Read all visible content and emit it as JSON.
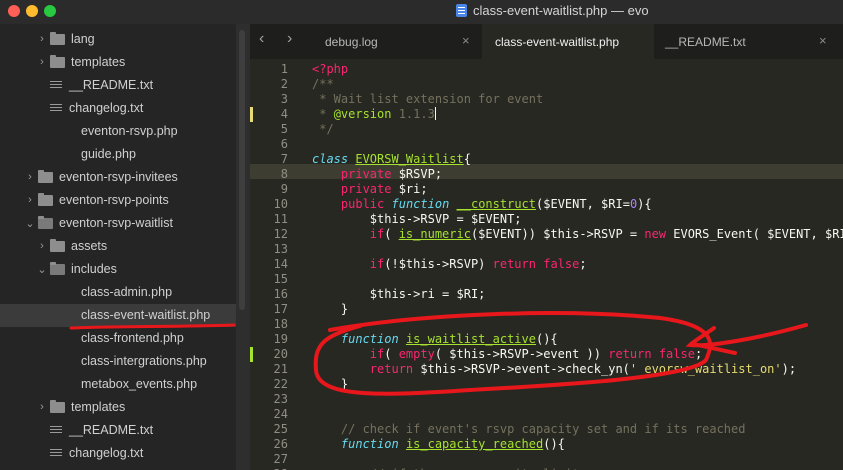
{
  "window": {
    "title": "class-event-waitlist.php — evo"
  },
  "colors": {
    "annotation_red": "#e8171b",
    "modified_marker_yellow": "#e6db74",
    "modified_marker_green": "#a6e22e"
  },
  "sidebar": {
    "items": [
      {
        "label": "lang",
        "type": "folder",
        "state": "collapsed"
      },
      {
        "label": "templates",
        "type": "folder",
        "state": "collapsed"
      },
      {
        "label": "__README.txt",
        "type": "file"
      },
      {
        "label": "changelog.txt",
        "type": "file"
      },
      {
        "label": "eventon-rsvp.php",
        "type": "file"
      },
      {
        "label": "guide.php",
        "type": "file"
      },
      {
        "label": "eventon-rsvp-invitees",
        "type": "folder",
        "state": "collapsed"
      },
      {
        "label": "eventon-rsvp-points",
        "type": "folder",
        "state": "collapsed"
      },
      {
        "label": "eventon-rsvp-waitlist",
        "type": "folder",
        "state": "expanded"
      },
      {
        "label": "assets",
        "type": "folder",
        "state": "collapsed"
      },
      {
        "label": "includes",
        "type": "folder",
        "state": "expanded"
      },
      {
        "label": "class-admin.php",
        "type": "file"
      },
      {
        "label": "class-event-waitlist.php",
        "type": "file",
        "selected": true
      },
      {
        "label": "class-frontend.php",
        "type": "file"
      },
      {
        "label": "class-intergrations.php",
        "type": "file"
      },
      {
        "label": "metabox_events.php",
        "type": "file"
      },
      {
        "label": "templates",
        "type": "folder",
        "state": "collapsed"
      },
      {
        "label": "__README.txt",
        "type": "file"
      },
      {
        "label": "changelog.txt",
        "type": "file"
      }
    ]
  },
  "tabs": [
    {
      "label": "debug.log",
      "close": "×"
    },
    {
      "label": "class-event-waitlist.php",
      "close": "",
      "active": true
    },
    {
      "label": "__README.txt",
      "close": "×"
    }
  ],
  "nav": {
    "back": "‹",
    "forward": "›"
  },
  "editor": {
    "lines": [
      {
        "n": "1",
        "t": [
          [
            "php",
            "<?php"
          ]
        ]
      },
      {
        "n": "2",
        "t": [
          [
            "cm",
            "/**"
          ]
        ]
      },
      {
        "n": "3",
        "t": [
          [
            "cm",
            " * Wait list extension for event"
          ]
        ]
      },
      {
        "n": "4",
        "t": [
          [
            "cm",
            " * "
          ],
          [
            "doc",
            "@version"
          ],
          [
            "cm",
            " 1.1.3"
          ]
        ],
        "caret": true,
        "marker": "yellow"
      },
      {
        "n": "5",
        "t": [
          [
            "cm",
            " */"
          ]
        ]
      },
      {
        "n": "6",
        "t": []
      },
      {
        "n": "7",
        "t": [
          [
            "sp",
            "class"
          ],
          [
            "",
            " "
          ],
          [
            "cls",
            "EVORSW_Waitlist"
          ],
          [
            "",
            "{"
          ]
        ]
      },
      {
        "n": "8",
        "t": [
          [
            "",
            "    "
          ],
          [
            "kw",
            "private"
          ],
          [
            "",
            " $RSVP;"
          ]
        ]
      },
      {
        "n": "9",
        "t": [
          [
            "",
            "    "
          ],
          [
            "kw",
            "private"
          ],
          [
            "",
            " $ri;"
          ]
        ]
      },
      {
        "n": "10",
        "t": [
          [
            "",
            "    "
          ],
          [
            "kw",
            "public"
          ],
          [
            "",
            " "
          ],
          [
            "sp",
            "function"
          ],
          [
            "",
            " "
          ],
          [
            "fn",
            "__construct"
          ],
          [
            "",
            "($EVENT, $RI="
          ],
          [
            "num",
            "0"
          ],
          [
            "",
            "){"
          ]
        ]
      },
      {
        "n": "11",
        "t": [
          [
            "",
            "        $this->RSVP = $EVENT;"
          ]
        ]
      },
      {
        "n": "12",
        "t": [
          [
            "",
            "        "
          ],
          [
            "kw",
            "if"
          ],
          [
            "",
            "( "
          ],
          [
            "fn",
            "is_numeric"
          ],
          [
            "",
            "($EVENT)) $this->RSVP = "
          ],
          [
            "kw",
            "new"
          ],
          [
            "",
            " EVORS_Event( $EVENT, $RI);"
          ]
        ]
      },
      {
        "n": "13",
        "t": []
      },
      {
        "n": "14",
        "t": [
          [
            "",
            "        "
          ],
          [
            "kw",
            "if"
          ],
          [
            "",
            "(!$this->RSVP) "
          ],
          [
            "kw",
            "return"
          ],
          [
            "",
            " "
          ],
          [
            "kw",
            "false"
          ],
          [
            "",
            ";"
          ]
        ]
      },
      {
        "n": "15",
        "t": []
      },
      {
        "n": "16",
        "t": [
          [
            "",
            "        $this->ri = $RI;"
          ]
        ]
      },
      {
        "n": "17",
        "t": [
          [
            "",
            "    }"
          ]
        ]
      },
      {
        "n": "18",
        "t": []
      },
      {
        "n": "19",
        "t": [
          [
            "",
            "    "
          ],
          [
            "sp",
            "function"
          ],
          [
            "",
            " "
          ],
          [
            "fn",
            "is_waitlist_active"
          ],
          [
            "",
            "(){"
          ]
        ]
      },
      {
        "n": "20",
        "t": [
          [
            "",
            "        "
          ],
          [
            "kw",
            "if"
          ],
          [
            "",
            "( "
          ],
          [
            "kw",
            "empty"
          ],
          [
            "",
            "( $this->RSVP->event )) "
          ],
          [
            "kw",
            "return"
          ],
          [
            "",
            " "
          ],
          [
            "kw",
            "false"
          ],
          [
            "",
            ";"
          ]
        ],
        "marker": "green"
      },
      {
        "n": "21",
        "t": [
          [
            "",
            "        "
          ],
          [
            "kw",
            "return"
          ],
          [
            "",
            " $this->RSVP->event->check_yn("
          ],
          [
            "str",
            "'_evorsw_waitlist_on'"
          ],
          [
            "",
            ");"
          ]
        ]
      },
      {
        "n": "22",
        "t": [
          [
            "",
            "    }"
          ]
        ]
      },
      {
        "n": "23",
        "t": []
      },
      {
        "n": "24",
        "t": []
      },
      {
        "n": "25",
        "t": [
          [
            "",
            "    "
          ],
          [
            "cm",
            "// check if event's rsvp capacity set and if its reached"
          ]
        ]
      },
      {
        "n": "26",
        "t": [
          [
            "",
            "    "
          ],
          [
            "sp",
            "function"
          ],
          [
            "",
            " "
          ],
          [
            "fn",
            "is_capacity_reached"
          ],
          [
            "",
            "(){"
          ]
        ]
      },
      {
        "n": "27",
        "t": []
      },
      {
        "n": "28",
        "t": [
          [
            "",
            "        "
          ],
          [
            "cm",
            "// if the rsvp capacity limit"
          ]
        ]
      }
    ]
  }
}
